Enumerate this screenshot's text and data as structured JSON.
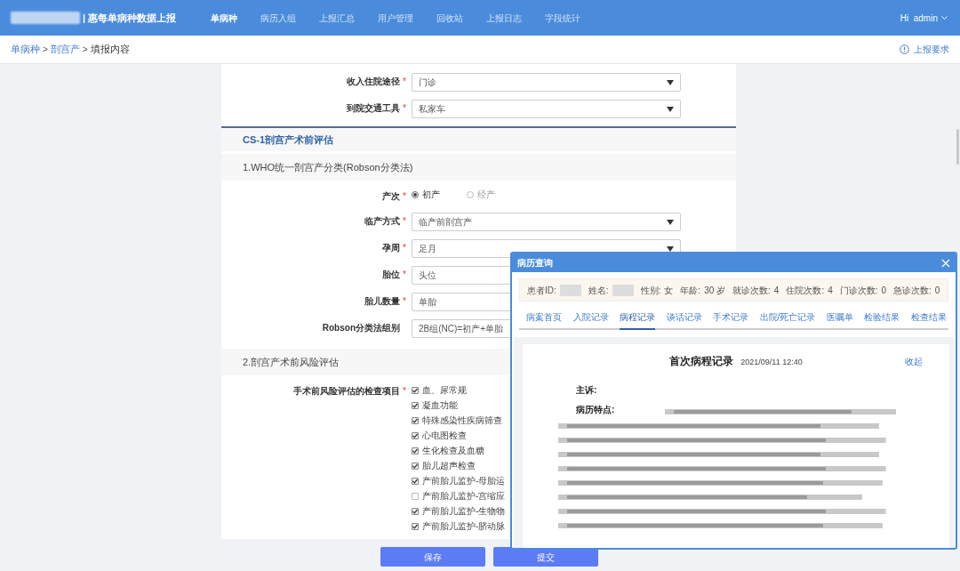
{
  "header": {
    "title": "| 惠每单病种数据上报",
    "nav": [
      {
        "label": "单病种",
        "selected": true
      },
      {
        "label": "病历入组",
        "selected": false
      },
      {
        "label": "上报汇总",
        "selected": false
      },
      {
        "label": "用户管理",
        "selected": false
      },
      {
        "label": "回收站",
        "selected": false
      },
      {
        "label": "上报日志",
        "selected": false
      },
      {
        "label": "字段统计",
        "selected": false
      }
    ],
    "user": "Hi  admin"
  },
  "breadcrumb": {
    "separator": ">",
    "items": [
      "单病种",
      "剖宫产"
    ],
    "current": "填报内容",
    "help": "上报要求"
  },
  "form": {
    "required_mark": "*",
    "top_fields": [
      {
        "kind": "select",
        "label": "收入住院途径",
        "required": true,
        "value": "门诊"
      },
      {
        "kind": "select",
        "label": "到院交通工具",
        "required": true,
        "value": "私家车"
      }
    ],
    "section_title": "CS-1剖宫产术前评估",
    "groups": [
      {
        "title": "1.WHO统一剖宫产分类(Robson分类法)",
        "fields": [
          {
            "kind": "radio",
            "label": "产次",
            "required": true,
            "options": [
              {
                "label": "初产",
                "selected": true
              },
              {
                "label": "经产",
                "selected": false
              }
            ]
          },
          {
            "kind": "select",
            "label": "临产方式",
            "required": true,
            "value": "临产前剖宫产"
          },
          {
            "kind": "select",
            "label": "孕周",
            "required": true,
            "value": "足月"
          },
          {
            "kind": "select",
            "label": "胎位",
            "required": true,
            "value": "头位"
          },
          {
            "kind": "select",
            "label": "胎儿数量",
            "required": true,
            "value": "单胎"
          },
          {
            "kind": "select",
            "label": "Robson分类法组别",
            "required": false,
            "value": "2B组(NC)=初产+单胎"
          }
        ]
      },
      {
        "title": "2.剖宫产术前风险评估",
        "fields": [
          {
            "kind": "checklist",
            "label": "手术前风险评估的检查项目",
            "required": true,
            "items": [
              {
                "label": "血、尿常规",
                "checked": true
              },
              {
                "label": "凝血功能",
                "checked": true
              },
              {
                "label": "特殊感染性疾病筛查",
                "checked": true
              },
              {
                "label": "心电图检查",
                "checked": true
              },
              {
                "label": "生化检查及血糖",
                "checked": true
              },
              {
                "label": "胎儿超声检查",
                "checked": true
              },
              {
                "label": "产前胎儿监护-母胎运",
                "checked": true
              },
              {
                "label": "产前胎儿监护-宫缩应",
                "checked": false
              },
              {
                "label": "产前胎儿监护-生物物",
                "checked": true
              },
              {
                "label": "产前胎儿监护-脐动脉",
                "checked": true
              }
            ]
          }
        ]
      }
    ]
  },
  "buttons": [
    "保存",
    "提交"
  ],
  "modal": {
    "title": "病历查询",
    "info": [
      {
        "kind": "redacted",
        "label": "患者ID:"
      },
      {
        "kind": "redacted",
        "label": "姓名:"
      },
      {
        "kind": "text",
        "label": "性别:",
        "value": "女"
      },
      {
        "kind": "text",
        "label": "年龄:",
        "value": "30 岁"
      },
      {
        "kind": "text",
        "label": "就诊次数:",
        "value": "4"
      },
      {
        "kind": "text",
        "label": "住院次数:",
        "value": "4"
      },
      {
        "kind": "text",
        "label": "门诊次数:",
        "value": "0"
      },
      {
        "kind": "text",
        "label": "急诊次数:",
        "value": "0"
      }
    ],
    "tabs": [
      {
        "label": "病案首页",
        "selected": false
      },
      {
        "label": "入院记录",
        "selected": false
      },
      {
        "label": "病程记录",
        "selected": true
      },
      {
        "label": "谈话记录",
        "selected": false
      },
      {
        "label": "手术记录",
        "selected": false
      },
      {
        "label": "出院/死亡记录",
        "selected": false
      },
      {
        "label": "医嘱单",
        "selected": false
      },
      {
        "label": "检验结果",
        "selected": false
      },
      {
        "label": "检查结果",
        "selected": false
      }
    ],
    "record": {
      "title": "首次病程记录",
      "time": "2021/09/11 12:40",
      "collapse": "收起",
      "complaint_label": "主诉:",
      "features_label": "病历特点:"
    }
  }
}
